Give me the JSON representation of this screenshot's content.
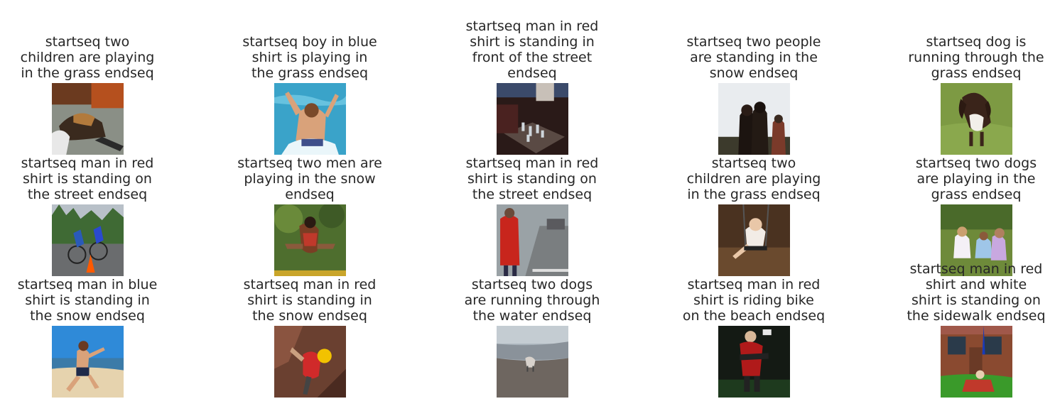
{
  "figure": {
    "cells": [
      {
        "caption": "startseq two\nchildren are playing\nin the grass endseq",
        "scene": "dog lying on floor"
      },
      {
        "caption": "startseq boy in blue\nshirt is playing in\nthe grass endseq",
        "scene": "boy splashing in pool"
      },
      {
        "caption": "startseq man in red\nshirt is standing in\nfront of the street\nendseq",
        "scene": "dark scene with glass chess pieces"
      },
      {
        "caption": "startseq two people\nare standing in the\nsnow endseq",
        "scene": "people silhouetted against sky"
      },
      {
        "caption": "startseq dog is\nrunning through the\ngrass endseq",
        "scene": "spaniel running in grass"
      },
      {
        "caption": "startseq man in red\nshirt is standing on\nthe street endseq",
        "scene": "cyclists racing past cone"
      },
      {
        "caption": "startseq two men are\nplaying in the snow\nendseq",
        "scene": "child jumping outdoors"
      },
      {
        "caption": "startseq man in red\nshirt is standing on\nthe street endseq",
        "scene": "man in red jacket on street"
      },
      {
        "caption": "startseq two\nchildren are playing\nin the grass endseq",
        "scene": "child on swing"
      },
      {
        "caption": "startseq two dogs\nare playing in the\ngrass endseq",
        "scene": "girls sitting on grass"
      },
      {
        "caption": "startseq man in blue\nshirt is standing in\nthe snow endseq",
        "scene": "boy on beach"
      },
      {
        "caption": "startseq man in red\nshirt is standing in\nthe snow endseq",
        "scene": "climber on rock"
      },
      {
        "caption": "startseq two dogs\nare running through\nthe water endseq",
        "scene": "dog on beach shore"
      },
      {
        "caption": "startseq man in red\nshirt is riding bike\non the beach endseq",
        "scene": "person in red at night"
      },
      {
        "caption": "startseq man in red\nshirt and white\nshirt is standing on\nthe sidewalk endseq",
        "scene": "people sitting on lawn by house"
      }
    ]
  }
}
